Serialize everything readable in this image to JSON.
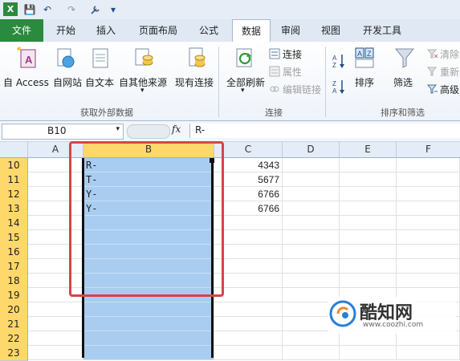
{
  "qat": {
    "save": "💾",
    "undo": "↶",
    "redo": "↷",
    "more": "▾"
  },
  "tabs": [
    "文件",
    "开始",
    "插入",
    "页面布局",
    "公式",
    "数据",
    "审阅",
    "视图",
    "开发工具"
  ],
  "ribbon": {
    "external_data": {
      "buttons": [
        "自 Access",
        "自网站",
        "自文本",
        "自其他来源",
        "现有连接"
      ],
      "group_label": "获取外部数据"
    },
    "connections": {
      "refresh_all": "全部刷新",
      "items": [
        "连接",
        "属性",
        "编辑链接"
      ],
      "group_label": "连接"
    },
    "sort_filter": {
      "sort": "排序",
      "filter": "筛选",
      "items": [
        "清除",
        "重新",
        "高级"
      ],
      "group_label": "排序和筛选"
    }
  },
  "formula_bar": {
    "name_box": "B10",
    "fx": "fx",
    "formula": "R-"
  },
  "grid": {
    "columns": [
      "A",
      "B",
      "C",
      "D",
      "E",
      "F"
    ],
    "rows": [
      {
        "n": "10",
        "b": "R-",
        "c": "4343"
      },
      {
        "n": "11",
        "b": "T-",
        "c": "5677"
      },
      {
        "n": "12",
        "b": "Y-",
        "c": "6766"
      },
      {
        "n": "13",
        "b": "Y-",
        "c": "6766"
      },
      {
        "n": "14",
        "b": "",
        "c": ""
      },
      {
        "n": "15",
        "b": "",
        "c": ""
      },
      {
        "n": "16",
        "b": "",
        "c": ""
      },
      {
        "n": "17",
        "b": "",
        "c": ""
      },
      {
        "n": "18",
        "b": "",
        "c": ""
      },
      {
        "n": "19",
        "b": "",
        "c": ""
      },
      {
        "n": "20",
        "b": "",
        "c": ""
      },
      {
        "n": "21",
        "b": "",
        "c": ""
      },
      {
        "n": "22",
        "b": "",
        "c": ""
      },
      {
        "n": "23",
        "b": "",
        "c": ""
      }
    ]
  },
  "watermark": {
    "brand": "酷知网",
    "url": "www.coozhi.com"
  },
  "colors": {
    "selection": "#a9cdf0",
    "highlight_box": "#d64545",
    "file_tab": "#2a8a3e"
  }
}
